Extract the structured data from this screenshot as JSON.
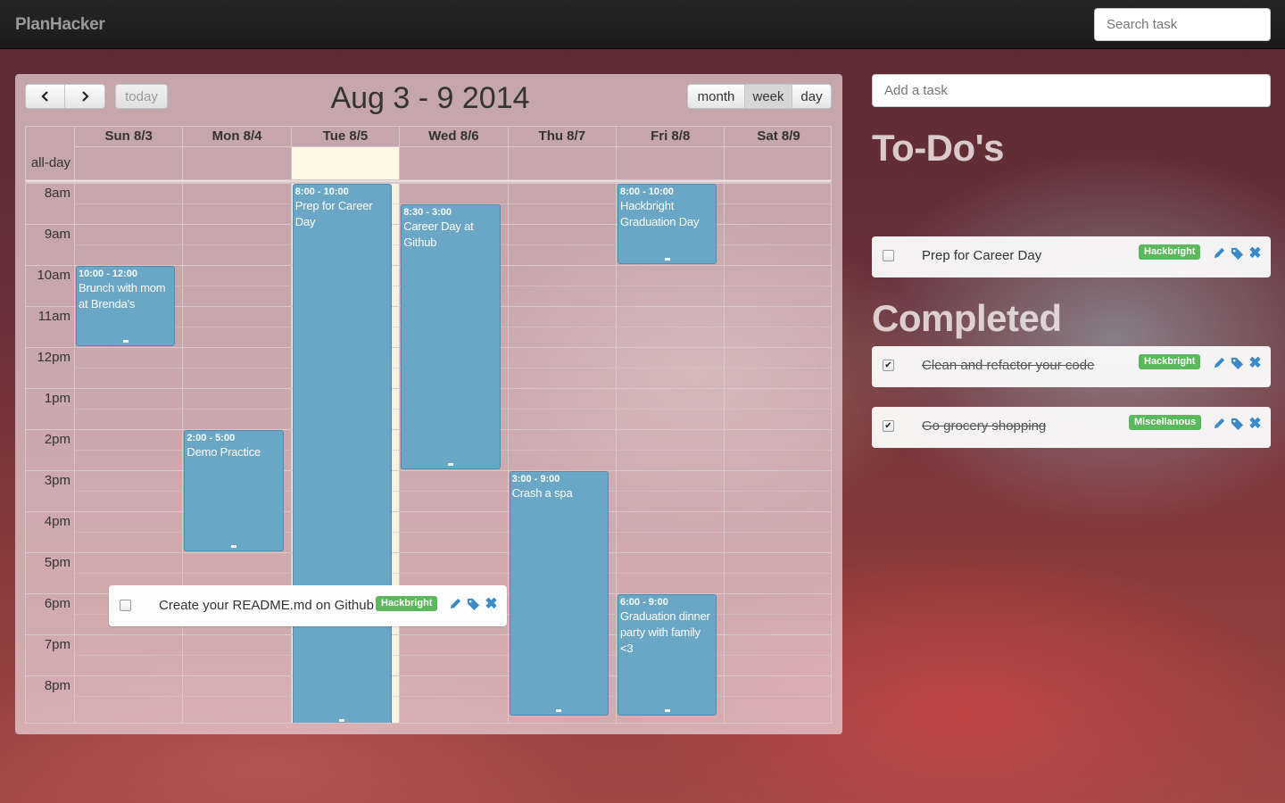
{
  "app": {
    "brand": "PlanHacker"
  },
  "search": {
    "placeholder": "Search task"
  },
  "calendar": {
    "title": "Aug 3 - 9 2014",
    "today_label": "today",
    "prev_icon": "chevron-left-icon",
    "next_icon": "chevron-right-icon",
    "views": {
      "month": "month",
      "week": "week",
      "day": "day",
      "active": "week"
    },
    "allday_label": "all-day",
    "days": [
      "Sun 8/3",
      "Mon 8/4",
      "Tue 8/5",
      "Wed 8/6",
      "Thu 8/7",
      "Fri 8/8",
      "Sat 8/9"
    ],
    "today_index": 2,
    "times": [
      "8am",
      "9am",
      "10am",
      "11am",
      "12pm",
      "1pm",
      "2pm",
      "3pm",
      "4pm",
      "5pm",
      "6pm",
      "7pm",
      "8pm"
    ],
    "events": [
      {
        "day": 0,
        "start": 10,
        "end": 12,
        "time": "10:00 - 12:00",
        "title": "Brunch with mom at Brenda's"
      },
      {
        "day": 1,
        "start": 14,
        "end": 17,
        "time": "2:00 - 5:00",
        "title": "Demo Practice"
      },
      {
        "day": 2,
        "start": 8,
        "end": 22,
        "time": "8:00 - 10:00",
        "title": "Prep for Career Day"
      },
      {
        "day": 3,
        "start": 8.5,
        "end": 15,
        "time": "8:30 - 3:00",
        "title": "Career Day at Github"
      },
      {
        "day": 4,
        "start": 15,
        "end": 21,
        "time": "3:00 - 9:00",
        "title": "Crash a spa"
      },
      {
        "day": 5,
        "start": 8,
        "end": 10,
        "time": "8:00 - 10:00",
        "title": "Hackbright Graduation Day"
      },
      {
        "day": 5,
        "start": 18,
        "end": 21,
        "time": "6:00 - 9:00",
        "title": "Graduation dinner party with family <3"
      }
    ]
  },
  "dragging_task": {
    "text": "Create your README.md on Github",
    "tag": "Hackbright",
    "tag_color": "#5cb85c"
  },
  "add_task": {
    "placeholder": "Add a task"
  },
  "todos": {
    "heading": "To-Do's",
    "items": [
      {
        "text": "Prep for Career Day",
        "tag": "Hackbright",
        "checked": false
      }
    ]
  },
  "completed": {
    "heading": "Completed",
    "items": [
      {
        "text": "Clean and refactor your code",
        "tag": "Hackbright",
        "checked": true
      },
      {
        "text": "Go grocery shopping",
        "tag": "Miscellanous",
        "checked": true
      }
    ]
  },
  "colors": {
    "event_bg": "#6aa6c6",
    "tag_green": "#5cb85c",
    "icon_blue": "#3a89c9"
  }
}
